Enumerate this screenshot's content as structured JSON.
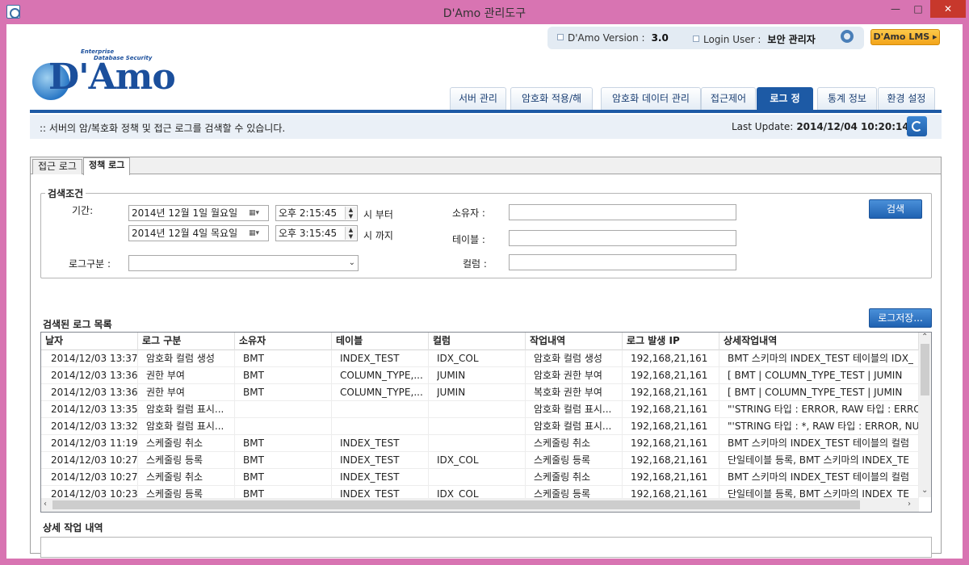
{
  "window": {
    "title": "D'Amo 관리도구",
    "minimize": "—",
    "maximize": "□",
    "close": "✕"
  },
  "logo": {
    "text": "D'Amo",
    "sub1": "Enterprise",
    "sub2": "Database Security"
  },
  "header": {
    "version_label": "D'Amo Version :",
    "version_value": "3.0",
    "login_label": "Login User :",
    "login_value": "보안 관리자",
    "lms_button": "D'Amo LMS ▸"
  },
  "menu": [
    "서버 관리",
    "암호화 적용/해제",
    "암호화 데이터 관리",
    "접근제어",
    "로그 정보",
    "통계 정보",
    "환경 설정"
  ],
  "menu_active": "로그 정보",
  "description": ":: 서버의 암/복호화 정책 및 접근 로그를 검색할 수 있습니다.",
  "last_update": {
    "label": "Last Update:",
    "value": "2014/12/04 10:20:14"
  },
  "tabs": [
    "접근 로그",
    "정책 로그"
  ],
  "tab_active": "정책 로그",
  "search": {
    "group_title": "검색조건",
    "period_label": "기간:",
    "date_from": "2014년 12월   1일 월요일",
    "time_from": "오후   2:15:45",
    "from_suffix": "시 부터",
    "date_to": "2014년 12월   4일 목요일",
    "time_to": "오후   3:15:45",
    "to_suffix": "시 까지",
    "log_type_label": "로그구분 :",
    "log_type_value": "",
    "owner_label": "소유자 :",
    "owner_value": "",
    "table_label": "테이블 :",
    "table_value": "",
    "column_label": "컬럼 :",
    "column_value": "",
    "search_button": "검색"
  },
  "results": {
    "title": "검색된 로그 목록",
    "save_button": "로그저장...",
    "columns": [
      "날자",
      "로그 구분",
      "소유자",
      "테이블",
      "컬럼",
      "작업내역",
      "로그 발생 IP",
      "상세작업내역"
    ],
    "rows": [
      [
        "2014/12/03 13:37,...",
        "암호화 컬럼 생성",
        "BMT",
        "INDEX_TEST",
        "IDX_COL",
        "암호화 컬럼 생성",
        "192,168,21,161",
        "BMT 스키마의 INDEX_TEST 테이블의 IDX_"
      ],
      [
        "2014/12/03 13:36,...",
        "권한 부여",
        "BMT",
        "COLUMN_TYPE,...",
        "JUMIN",
        "암호화 권한 부여",
        "192,168,21,161",
        "[ BMT | COLUMN_TYPE_TEST | JUMIN"
      ],
      [
        "2014/12/03 13:36,...",
        "권한 부여",
        "BMT",
        "COLUMN_TYPE,...",
        "JUMIN",
        "복호화 권한 부여",
        "192,168,21,161",
        "[ BMT | COLUMN_TYPE_TEST | JUMIN"
      ],
      [
        "2014/12/03 13:35,...",
        "암호화 컬럼 표시...",
        "",
        "",
        "",
        "암호화 컬럼 표시...",
        "192,168,21,161",
        "\"'STRING 타입 : ERROR, RAW 타입 : ERRO"
      ],
      [
        "2014/12/03 13:32,...",
        "암호화 컬럼 표시...",
        "",
        "",
        "",
        "암호화 컬럼 표시...",
        "192,168,21,161",
        "\"'STRING 타입 : *, RAW 타입 : ERROR, NU"
      ],
      [
        "2014/12/03 11:19,...",
        "스케줄링 취소",
        "BMT",
        "INDEX_TEST",
        "",
        "스케줄링 취소",
        "192,168,21,161",
        "BMT 스키마의 INDEX_TEST 테이블의 컬럼"
      ],
      [
        "2014/12/03 10:27,...",
        "스케줄링 등록",
        "BMT",
        "INDEX_TEST",
        "IDX_COL",
        "스케줄링 등록",
        "192,168,21,161",
        "단일테이블 등록, BMT 스키마의 INDEX_TE"
      ],
      [
        "2014/12/03 10:27,...",
        "스케줄링 취소",
        "BMT",
        "INDEX_TEST",
        "",
        "스케줄링 취소",
        "192,168,21,161",
        "BMT 스키마의 INDEX_TEST 테이블의 컬럼"
      ],
      [
        "2014/12/03 10:23,...",
        "스케줄링 등록",
        "BMT",
        "INDEX_TEST",
        "IDX_COL",
        "스케줄링 등록",
        "192,168,21,161",
        "단일테이블 등록, BMT 스키마의 INDEX_TE"
      ]
    ]
  },
  "detail": {
    "title": "상세 작업 내역",
    "value": ""
  },
  "icons": {
    "app": "app-icon",
    "gear": "gear-icon",
    "refresh": "refresh-icon",
    "calendar": "calendar-icon",
    "dropdown": "chevron-down-icon"
  },
  "colors": {
    "window_frame": "#d874b2",
    "accent": "#1d5aa5",
    "lms_button": "#f3a41a",
    "close_button": "#c7382c"
  }
}
